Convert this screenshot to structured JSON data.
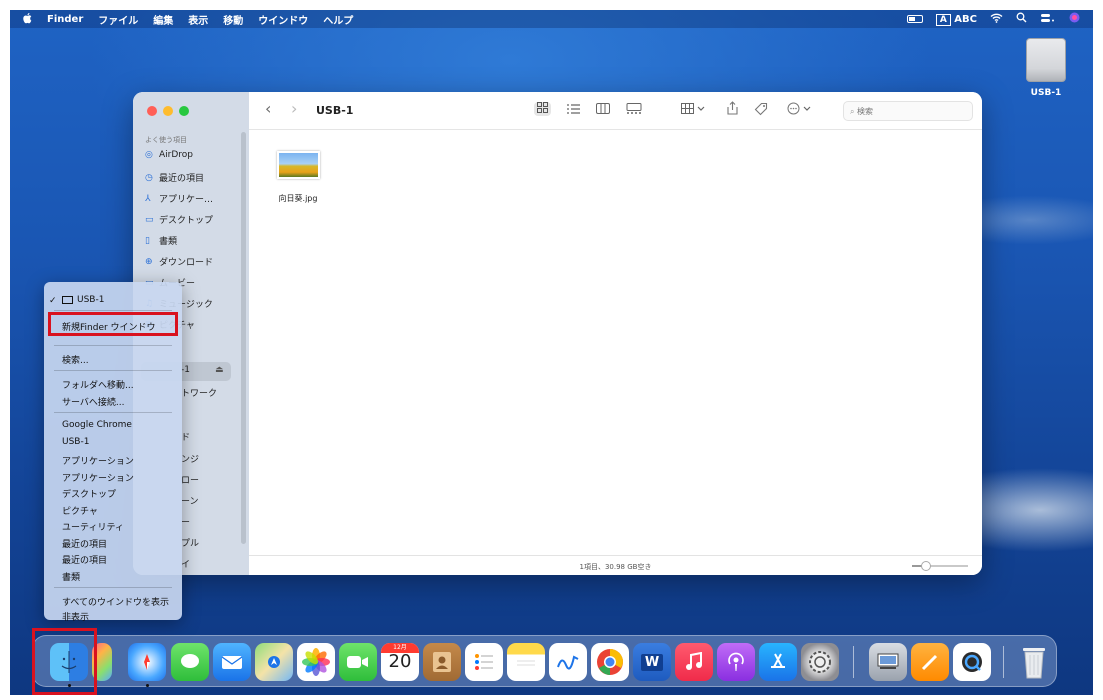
{
  "menubar": {
    "apple": "",
    "items": [
      "Finder",
      "ファイル",
      "編集",
      "表示",
      "移動",
      "ウインドウ",
      "ヘルプ"
    ],
    "input_mode": "A",
    "input_source": "ABC"
  },
  "desktop": {
    "usb_label": "USB-1"
  },
  "finder": {
    "title": "USB-1",
    "back": "‹",
    "forward": "›",
    "search_placeholder": "検索",
    "search_glyph": "⌕",
    "sidebar": {
      "heading": "よく使う項目",
      "items": [
        "AirDrop",
        "最近の項目",
        "アプリケー…",
        "デスクトップ",
        "書類",
        "ダウンロード",
        "ムービー",
        "ミュージック",
        "ピクチャ"
      ],
      "partials": [
        "-1",
        "トワーク",
        "ド",
        "ンジ",
        "ロー",
        "ーン",
        "ー",
        "プル",
        "イ"
      ],
      "eject": "⏏"
    },
    "files": [
      {
        "name": "向日葵.jpg"
      }
    ],
    "status": "1項目、30.98 GB空き"
  },
  "dock_menu": {
    "checked_item": "USB-1",
    "check_mark": "✓",
    "new_window": "新規Finder ウインドウ",
    "items_group1": [
      "検索..."
    ],
    "items_group2": [
      "フォルダへ移動...",
      "サーバへ接続..."
    ],
    "items_group3": [
      "Google Chrome",
      "USB-1",
      "アプリケーション",
      "アプリケーション",
      "デスクトップ",
      "ピクチャ",
      "ユーティリティ",
      "最近の項目",
      "最近の項目",
      "書類"
    ],
    "items_group4": [
      "すべてのウインドウを表示",
      "非表示"
    ]
  },
  "dock": {
    "calendar_month": "12月",
    "calendar_day": "20",
    "word_letter": "W"
  },
  "colors": {
    "highlight": "#d9121f",
    "accent": "#2a6fd6"
  }
}
